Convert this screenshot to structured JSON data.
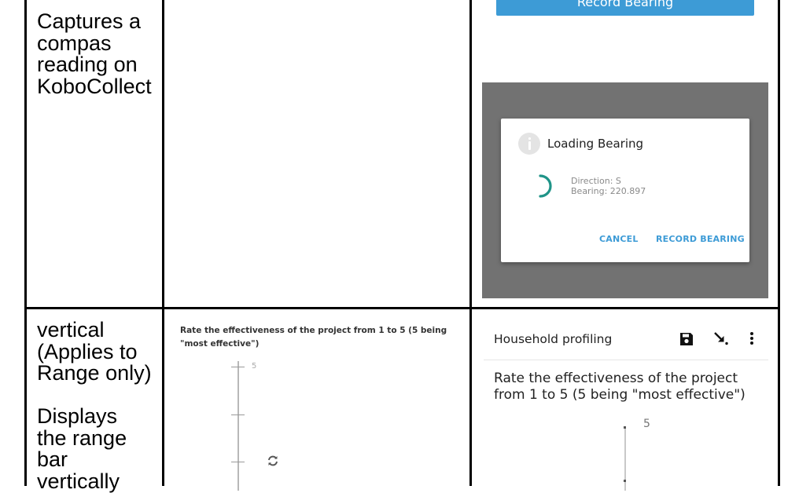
{
  "rows": [
    {
      "description_lines": [
        "Captures a",
        "compas",
        "reading on",
        "KoboCollect"
      ],
      "kobocollect": {
        "record_button_label": "Record Bearing",
        "dialog": {
          "title": "Loading Bearing",
          "direction": "Direction: S",
          "bearing": "Bearing: 220.897",
          "cancel_label": "CANCEL",
          "record_label": "RECORD BEARING"
        }
      }
    },
    {
      "description_lines": [
        "vertical",
        "(Applies to",
        "Range only)",
        "",
        "Displays",
        "the range",
        "bar",
        "vertically"
      ],
      "enketo": {
        "question": "Rate the effectiveness of the project from 1 to 5 (5 being \"most effective\")",
        "max_label": "5"
      },
      "kobocollect": {
        "form_title": "Household profiling",
        "question": "Rate the effectiveness of the project from 1 to 5 (5 being \"most effective\")",
        "max_label": "5",
        "toolbar_icons": [
          "save-icon",
          "jump-arrow-icon",
          "more-vert-icon"
        ]
      }
    }
  ],
  "colors": {
    "accent": "#3d9bd6",
    "spinner": "#1f9488",
    "overlay": "#727272",
    "grid": "#000000"
  }
}
